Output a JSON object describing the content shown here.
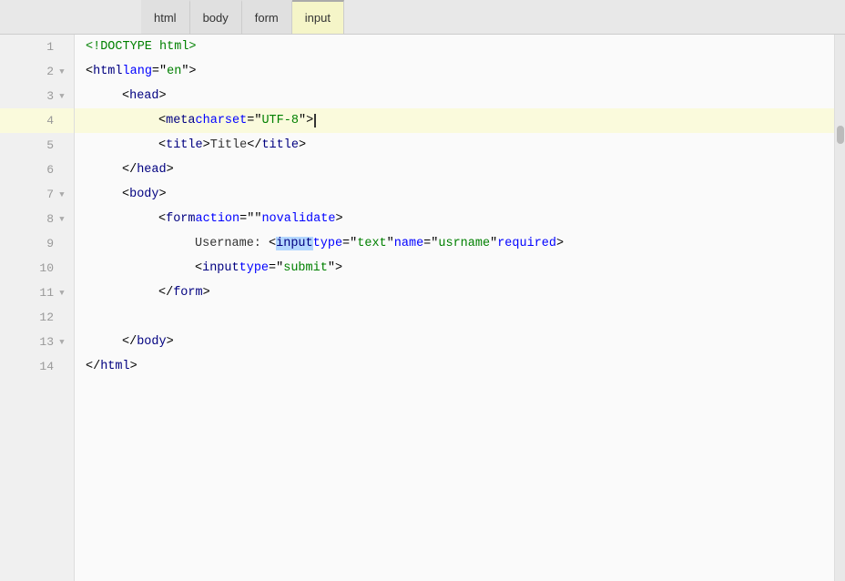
{
  "breadcrumbs": {
    "tabs": [
      {
        "label": "html",
        "active": false
      },
      {
        "label": "body",
        "active": false
      },
      {
        "label": "form",
        "active": false
      },
      {
        "label": "input",
        "active": true
      }
    ]
  },
  "editor": {
    "lines": [
      {
        "num": 1,
        "indent": 0,
        "content": "<!DOCTYPE html>",
        "foldable": false,
        "highlighted": false
      },
      {
        "num": 2,
        "indent": 0,
        "content": "<html lang=\"en\">",
        "foldable": true,
        "highlighted": false
      },
      {
        "num": 3,
        "indent": 1,
        "content": "<head>",
        "foldable": true,
        "highlighted": false
      },
      {
        "num": 4,
        "indent": 2,
        "content": "<meta charset=\"UTF-8\">",
        "foldable": false,
        "highlighted": true
      },
      {
        "num": 5,
        "indent": 2,
        "content": "<title>Title</title>",
        "foldable": false,
        "highlighted": false
      },
      {
        "num": 6,
        "indent": 1,
        "content": "</head>",
        "foldable": false,
        "highlighted": false
      },
      {
        "num": 7,
        "indent": 1,
        "content": "<body>",
        "foldable": true,
        "highlighted": false
      },
      {
        "num": 8,
        "indent": 2,
        "content": "<form action=\"\" novalidate>",
        "foldable": true,
        "highlighted": false
      },
      {
        "num": 9,
        "indent": 3,
        "content": "Username: <input type=\"text\" name=\"usrname\" required>",
        "foldable": false,
        "highlighted": false
      },
      {
        "num": 10,
        "indent": 3,
        "content": "<input type=\"submit\">",
        "foldable": false,
        "highlighted": false
      },
      {
        "num": 11,
        "indent": 2,
        "content": "</form>",
        "foldable": false,
        "highlighted": false
      },
      {
        "num": 12,
        "indent": 0,
        "content": "",
        "foldable": false,
        "highlighted": false
      },
      {
        "num": 13,
        "indent": 1,
        "content": "</body>",
        "foldable": false,
        "highlighted": false
      },
      {
        "num": 14,
        "indent": 0,
        "content": "</html>",
        "foldable": false,
        "highlighted": false
      }
    ]
  },
  "colors": {
    "highlighted_bg": "#fafadc",
    "tab_active_bg": "#f5f5c8",
    "selection_bg": "#b3d7ff"
  }
}
